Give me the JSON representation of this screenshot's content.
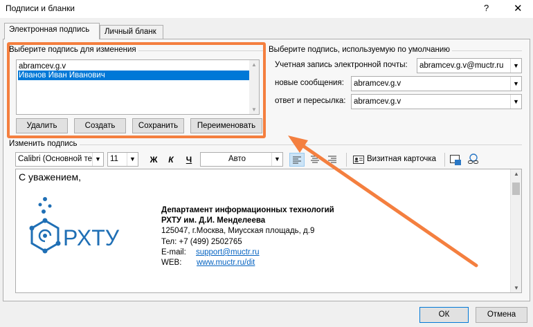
{
  "window": {
    "title": "Подписи и бланки",
    "help_label": "?",
    "close_label": "✕"
  },
  "tabs": [
    {
      "label": "Электронная подпись",
      "active": true
    },
    {
      "label": "Личный бланк",
      "active": false
    }
  ],
  "select_group": {
    "label": "Выберите подпись для изменения",
    "items": [
      {
        "label": "abramcev.g.v",
        "selected": false
      },
      {
        "label": "Иванов Иван Иванович",
        "selected": true
      }
    ],
    "buttons": {
      "delete": "Удалить",
      "create": "Создать",
      "save": "Сохранить",
      "rename": "Переименовать"
    }
  },
  "default_group": {
    "label": "Выберите подпись, используемую по умолчанию",
    "account_label": "Учетная запись электронной почты:",
    "account_value": "abramcev.g.v@muctr.ru",
    "new_messages_label": "новые сообщения:",
    "new_messages_value": "abramcev.g.v",
    "replies_label": "ответ и пересылка:",
    "replies_value": "abramcev.g.v"
  },
  "edit_group": {
    "label": "Изменить подпись",
    "font_value": "Calibri (Основной те",
    "size_value": "11",
    "bold_label": "Ж",
    "italic_label": "К",
    "underline_label": "Ч",
    "color_value": "Авто",
    "business_card_label": "Визитная карточка"
  },
  "signature": {
    "greeting": "С уважением,",
    "logo_text": "РХТУ",
    "dept": "Департамент информационных технологий",
    "org": "РХТУ им. Д.И. Менделеева",
    "address": "125047, г.Москва, Миусская площадь, д.9",
    "phone": "Тел: +7 (499) 2502765",
    "email_label": "E-mail:",
    "email": "support@muctr.ru",
    "web_label": "WEB:",
    "web": "www.muctr.ru/dit"
  },
  "footer": {
    "ok": "ОК",
    "cancel": "Отмена"
  },
  "colors": {
    "annotation": "#f47f3f",
    "selection": "#0078d7",
    "logo_blue": "#1f6fb5",
    "link": "#0563c1"
  }
}
